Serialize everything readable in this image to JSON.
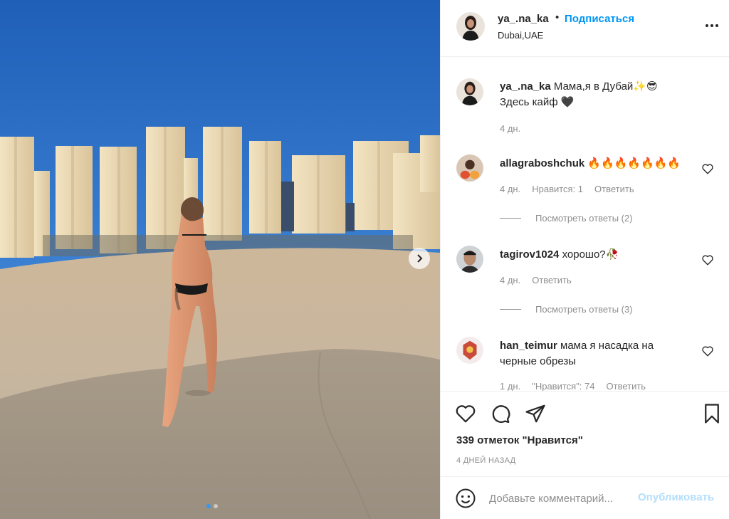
{
  "header": {
    "username": "ya_.na_ka",
    "separator": "•",
    "follow_label": "Подписаться",
    "location": "Dubai,UAE"
  },
  "caption": {
    "username": "ya_.na_ka",
    "text_line1": "Мама,я в Дубай✨😎",
    "text_line2": "Здесь кайф 🖤",
    "time": "4 дн."
  },
  "comments": [
    {
      "username": "allagraboshchuk",
      "text": "🔥🔥🔥🔥🔥🔥🔥",
      "time": "4 дн.",
      "likes_label": "Нравится: 1",
      "reply_label": "Ответить",
      "view_replies": "Посмотреть ответы (2)"
    },
    {
      "username": "tagirov1024",
      "text": "хорошо?🥀",
      "time": "4 дн.",
      "reply_label": "Ответить",
      "view_replies": "Посмотреть ответы (3)"
    },
    {
      "username": "han_teimur",
      "text": "мама я насадка на черные обрезы",
      "time": "1 дн.",
      "likes_label": "\"Нравится\": 74",
      "reply_label": "Ответить"
    }
  ],
  "actions": {
    "likes_text": "339 отметок \"Нравится\"",
    "time_ago": "4 ДНЕЙ НАЗАД"
  },
  "add_comment": {
    "placeholder": "Добавьте комментарий...",
    "publish_label": "Опубликовать"
  },
  "colors": {
    "accent": "#0095f6",
    "publish_disabled": "#b2dffc",
    "muted": "#8e8e8e",
    "text": "#262626",
    "carousel_active_dot": "#3897f0"
  },
  "icons": [
    "more-options-icon",
    "heart-icon",
    "comment-icon",
    "share-icon",
    "bookmark-icon",
    "emoji-icon",
    "chevron-right-icon"
  ],
  "carousel": {
    "total": 2,
    "active": 1
  }
}
